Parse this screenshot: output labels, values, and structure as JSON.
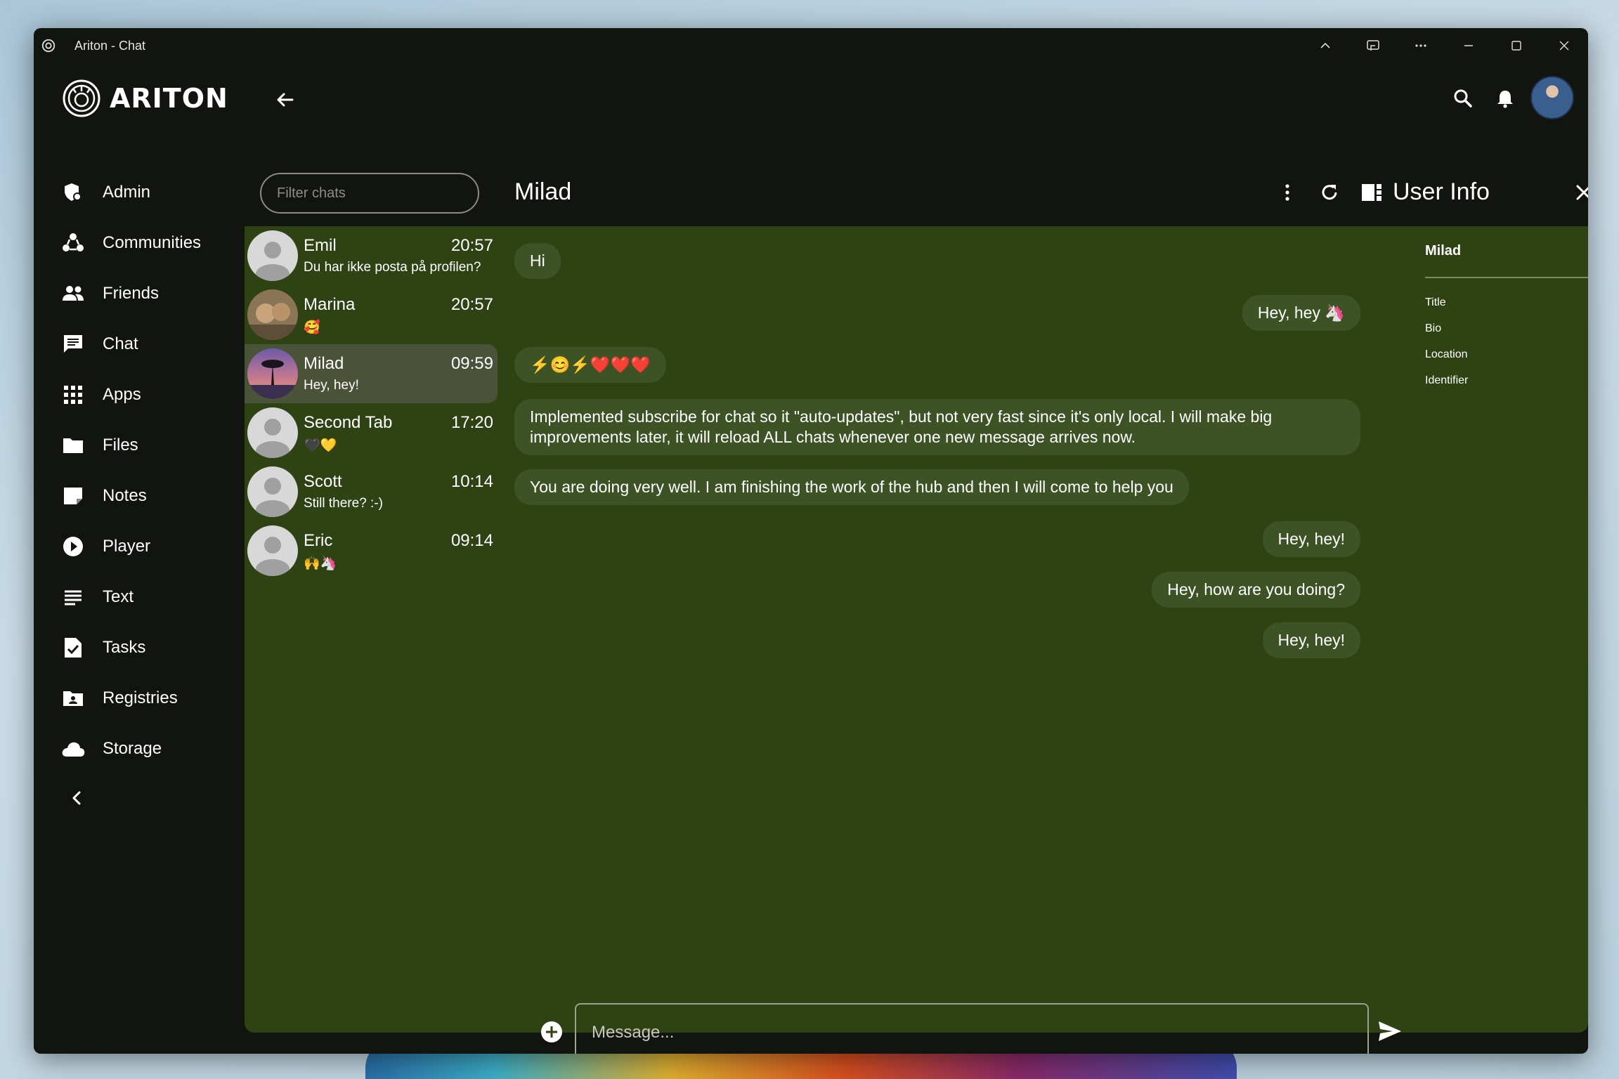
{
  "window": {
    "title": "Ariton - Chat"
  },
  "brand": {
    "name": "ARITON"
  },
  "sidebar": {
    "items": [
      {
        "label": "Admin",
        "icon": "admin-shield-icon"
      },
      {
        "label": "Communities",
        "icon": "communities-icon"
      },
      {
        "label": "Friends",
        "icon": "friends-icon"
      },
      {
        "label": "Chat",
        "icon": "chat-icon"
      },
      {
        "label": "Apps",
        "icon": "apps-grid-icon"
      },
      {
        "label": "Files",
        "icon": "folder-icon"
      },
      {
        "label": "Notes",
        "icon": "note-icon"
      },
      {
        "label": "Player",
        "icon": "play-icon"
      },
      {
        "label": "Text",
        "icon": "text-lines-icon"
      },
      {
        "label": "Tasks",
        "icon": "task-check-icon"
      },
      {
        "label": "Registries",
        "icon": "registry-folder-icon"
      },
      {
        "label": "Storage",
        "icon": "cloud-icon"
      }
    ]
  },
  "search": {
    "placeholder": "Filter chats"
  },
  "chats": [
    {
      "name": "Emil",
      "time": "20:57",
      "preview": "Du har ikke posta på profilen?"
    },
    {
      "name": "Marina",
      "time": "20:57",
      "preview": "🥰"
    },
    {
      "name": "Milad",
      "time": "09:59",
      "preview": "Hey, hey!"
    },
    {
      "name": "Second Tab",
      "time": "17:20",
      "preview": "🖤💛"
    },
    {
      "name": "Scott",
      "time": "10:14",
      "preview": "Still there? :-)"
    },
    {
      "name": "Eric",
      "time": "09:14",
      "preview": "🙌🦄"
    }
  ],
  "conversation": {
    "name": "Milad",
    "messages": [
      {
        "text": "Hi",
        "direction": "in"
      },
      {
        "text": "Hey, hey 🦄",
        "direction": "out"
      },
      {
        "text": "⚡😊⚡❤️❤️❤️",
        "direction": "in"
      },
      {
        "text": "Implemented subscribe for chat so it \"auto-updates\", but not very fast since it's only local. I will make big improvements later, it will reload ALL chats whenever one new message arrives now.",
        "direction": "in"
      },
      {
        "text": "You are doing very well. I am finishing the work of the hub and then I will come to help you",
        "direction": "in"
      },
      {
        "text": "Hey, hey!",
        "direction": "out"
      },
      {
        "text": "Hey, how are you doing?",
        "direction": "out"
      },
      {
        "text": "Hey, hey!",
        "direction": "out"
      }
    ]
  },
  "user_info": {
    "title": "User Info",
    "name": "Milad",
    "fields": [
      "Title",
      "Bio",
      "Location",
      "Identifier"
    ]
  },
  "composer": {
    "placeholder": "Message..."
  },
  "colors": {
    "window_bg": "#121410",
    "chat_bg": "#2f4213",
    "bubble": "#3e5325",
    "selected_chat": "#4a5338"
  }
}
